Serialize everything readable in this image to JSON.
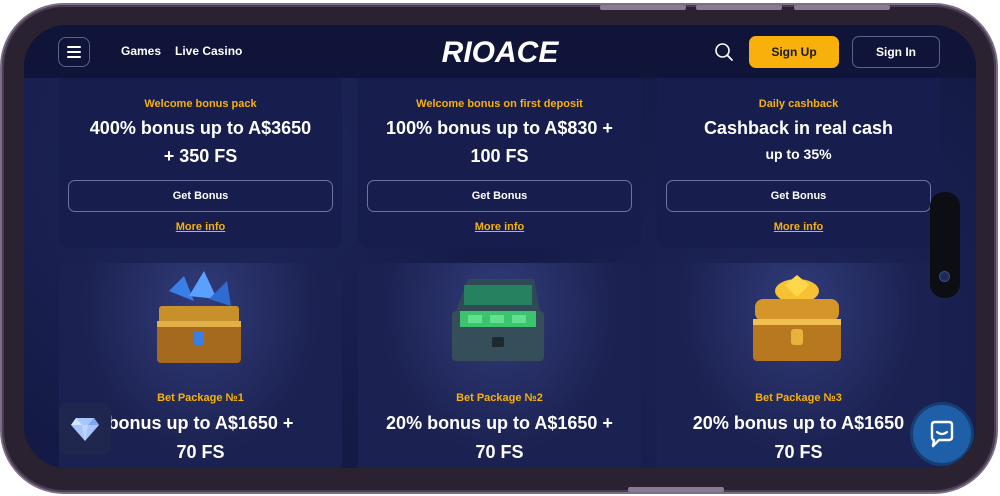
{
  "header": {
    "nav": [
      "Games",
      "Live Casino"
    ],
    "logo_text": "RIOACE",
    "signup_label": "Sign Up",
    "signin_label": "Sign In"
  },
  "top_cards": [
    {
      "label": "Welcome bonus pack",
      "title_line1": "400% bonus up to A$3650",
      "title_line2": "+ 350 FS",
      "button": "Get Bonus",
      "more": "More info"
    },
    {
      "label": "Welcome bonus on first deposit",
      "title_line1": "100% bonus up to A$830 +",
      "title_line2": "100 FS",
      "button": "Get Bonus",
      "more": "More info"
    },
    {
      "label": "Daily cashback",
      "title_line1": "Cashback in real cash",
      "title_line2": "up to 35%",
      "button": "Get Bonus",
      "more": "More info"
    }
  ],
  "bottom_cards": [
    {
      "label": "Bet Package №1",
      "title_line1": "bonus up to A$1650 +",
      "title_line2": "70 FS",
      "chest": "blue-crystal-chest-icon"
    },
    {
      "label": "Bet Package №2",
      "title_line1": "20% bonus up to A$1650 +",
      "title_line2": "70 FS",
      "chest": "money-chest-icon"
    },
    {
      "label": "Bet Package №3",
      "title_line1": "20% bonus up to A$1650",
      "title_line2": "70 FS",
      "chest": "gold-chest-icon"
    }
  ],
  "colors": {
    "accent": "#f7b10a",
    "background": "#141a45",
    "card": "#171d4c",
    "chat": "#1e5fa8"
  },
  "icons": {
    "menu": "menu-icon",
    "search": "search-icon",
    "diamond": "diamond-icon",
    "chat": "chat-icon"
  }
}
